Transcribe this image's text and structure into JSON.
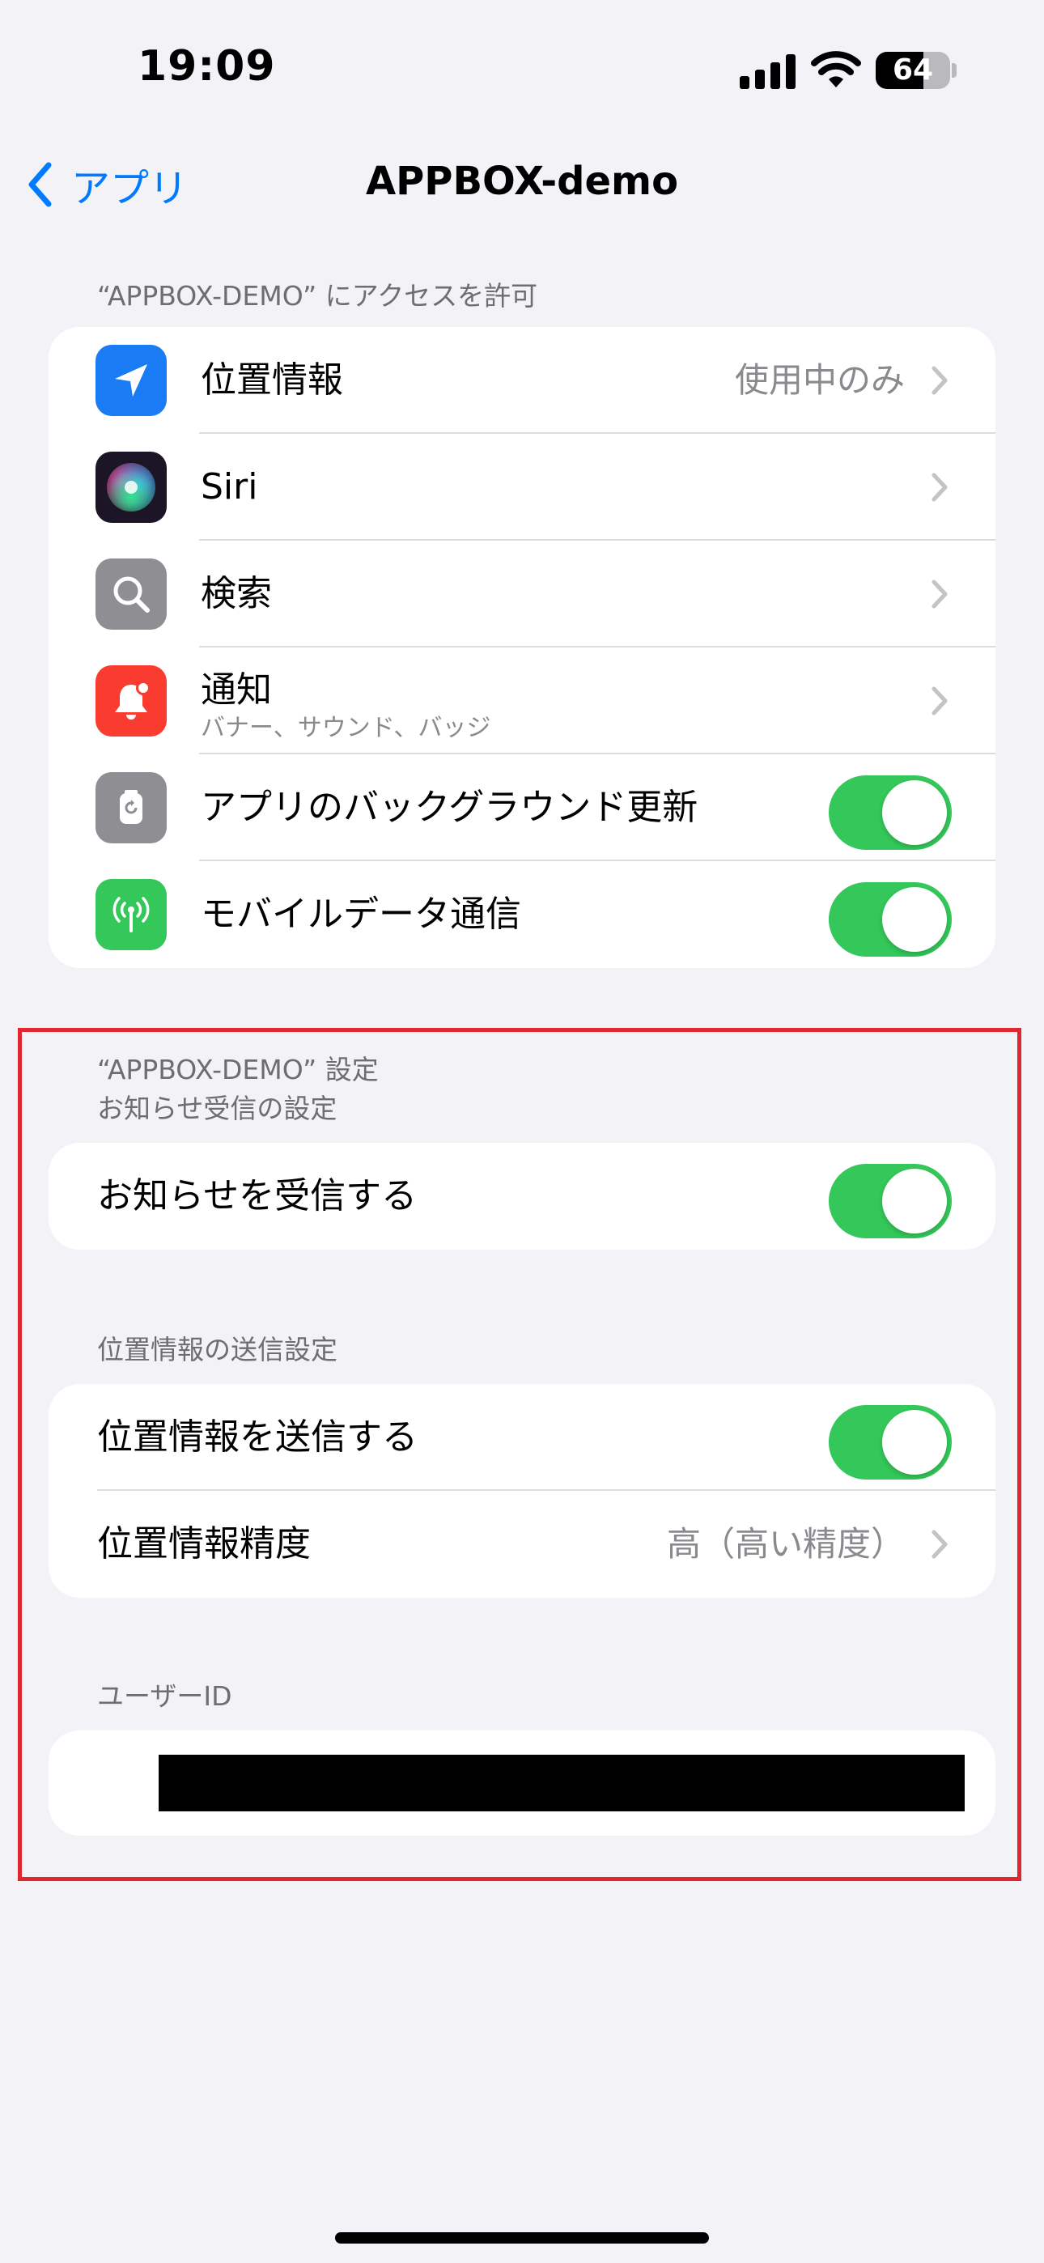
{
  "status_bar": {
    "time": "19:09",
    "battery_level": "64",
    "battery_fraction": 0.64
  },
  "nav": {
    "back_label": "アプリ",
    "title": "APPBOX-demo"
  },
  "access": {
    "header": "“APPBOX-DEMO” にアクセスを許可",
    "rows": [
      {
        "label": "位置情報",
        "value": "使用中のみ",
        "icon": "location-arrow-icon",
        "color": "#1a7cf4"
      },
      {
        "label": "Siri",
        "icon": "siri-icon"
      },
      {
        "label": "検索",
        "icon": "search-icon",
        "color": "#8e8e93"
      },
      {
        "label": "通知",
        "sublabel": "バナー、サウンド、バッジ",
        "icon": "notification-bell-icon",
        "color": "#fa3b30"
      },
      {
        "label": "アプリのバックグラウンド更新",
        "toggle": true,
        "icon": "background-refresh-icon",
        "color": "#8e8e93"
      },
      {
        "label": "モバイルデータ通信",
        "toggle": true,
        "icon": "cellular-antenna-icon",
        "color": "#34c759"
      }
    ]
  },
  "app_settings": {
    "header_line1": "“APPBOX-DEMO” 設定",
    "header_line2": "お知らせ受信の設定",
    "receive_notice": {
      "label": "お知らせを受信する",
      "toggle": true
    }
  },
  "location_settings": {
    "header": "位置情報の送信設定",
    "send_location": {
      "label": "位置情報を送信する",
      "toggle": true
    },
    "accuracy": {
      "label": "位置情報精度",
      "value": "高（高い精度）"
    }
  },
  "user_id": {
    "header": "ユーザーID",
    "redacted": true
  },
  "colors": {
    "accent": "#007aff",
    "toggle_on": "#34c759",
    "highlight": "#e0262e",
    "background": "#f2f2f7"
  }
}
